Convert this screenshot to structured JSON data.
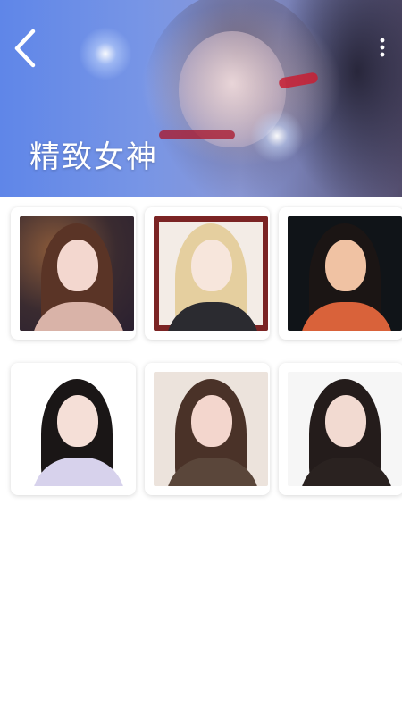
{
  "header": {
    "title": "精致女神",
    "back_icon": "chevron-left-icon",
    "more_icon": "more-vertical-icon",
    "banner_colors": [
      "#5f86e8",
      "#8a98d7",
      "#534d6d"
    ]
  },
  "grid": {
    "items": [
      {
        "name": "girl-sparkler"
      },
      {
        "name": "blonde-girl-framed"
      },
      {
        "name": "girl-red-glow"
      },
      {
        "name": "girl-school-uniform"
      },
      {
        "name": "girl-hand-on-cheek"
      },
      {
        "name": "girl-looking-up"
      }
    ]
  }
}
